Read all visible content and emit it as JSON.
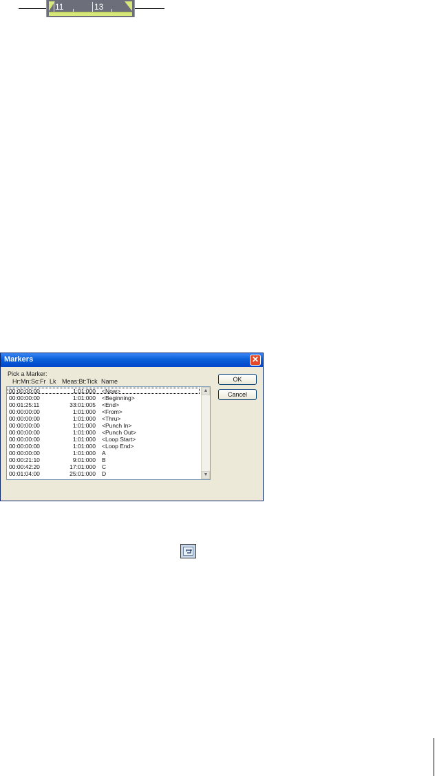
{
  "loop_ruler": {
    "start_measure": "11",
    "end_measure": "13"
  },
  "dialog": {
    "title": "Markers",
    "prompt": "Pick a Marker:",
    "columns": {
      "time": "Hr:Mn:Sc:Fr",
      "lock": "Lk",
      "meas": "Meas:Bt:Tick",
      "name": "Name"
    },
    "rows": [
      {
        "time": "00:00:00:00",
        "meas": "1:01:000",
        "name": "<Now>"
      },
      {
        "time": "00:00:00:00",
        "meas": "1:01:000",
        "name": "<Beginning>"
      },
      {
        "time": "00:01:25:11",
        "meas": "33:01:005",
        "name": "<End>"
      },
      {
        "time": "00:00:00:00",
        "meas": "1:01:000",
        "name": "<From>"
      },
      {
        "time": "00:00:00:00",
        "meas": "1:01:000",
        "name": "<Thru>"
      },
      {
        "time": "00:00:00:00",
        "meas": "1:01:000",
        "name": "<Punch In>"
      },
      {
        "time": "00:00:00:00",
        "meas": "1:01:000",
        "name": "<Punch Out>"
      },
      {
        "time": "00:00:00:00",
        "meas": "1:01:000",
        "name": "<Loop Start>"
      },
      {
        "time": "00:00:00:00",
        "meas": "1:01:000",
        "name": "<Loop End>"
      },
      {
        "time": "00:00:00:00",
        "meas": "1:01:000",
        "name": "A"
      },
      {
        "time": "00:00:21:10",
        "meas": "9:01:000",
        "name": "B"
      },
      {
        "time": "00:00:42:20",
        "meas": "17:01:000",
        "name": "C"
      },
      {
        "time": "00:01:04:00",
        "meas": "25:01:000",
        "name": "D"
      }
    ],
    "ok_label": "OK",
    "cancel_label": "Cancel",
    "close_glyph": "✕"
  },
  "icons": {
    "loop_toggle": "loop-toggle-icon"
  },
  "colors": {
    "loop_bar": "#d7e77a",
    "ruler_bg": "#6c6e7a",
    "title_bar": "#0a5fd8",
    "close_button": "#e24a2a",
    "dialog_bg": "#ece9d8"
  }
}
